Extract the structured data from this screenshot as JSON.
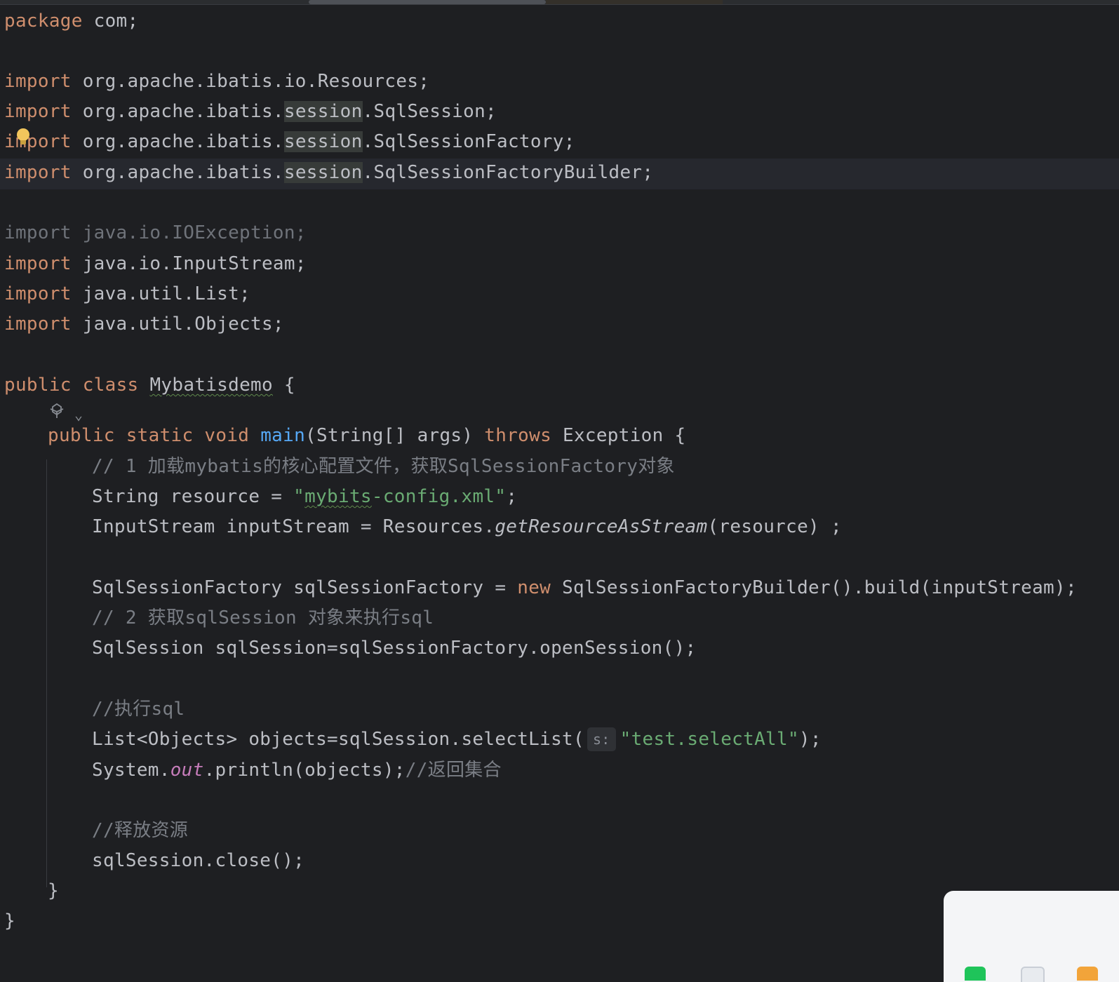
{
  "editor": {
    "lines": {
      "l01": {
        "kw": "package",
        "text": " com;"
      },
      "l03": {
        "kw": "import",
        "text": " org.apache.ibatis.io.Resources;"
      },
      "l04": {
        "kw": "import",
        "pre": " org.apache.ibatis.",
        "hl": "session",
        "post": ".SqlSession;"
      },
      "l05": {
        "kw": "import",
        "pre": " org.apache.ibatis.",
        "hl": "session",
        "post": ".SqlSessionFactory;"
      },
      "l06": {
        "kw": "import",
        "pre": " org.apache.ibatis.",
        "hl": "session",
        "post": ".SqlSessionFactoryBuilder;"
      },
      "l08": {
        "text": "import java.io.IOException;"
      },
      "l09": {
        "kw": "import",
        "text": " java.io.InputStream;"
      },
      "l10": {
        "kw": "import",
        "text": " java.util.List;"
      },
      "l11": {
        "kw": "import",
        "text": " java.util.Objects;"
      },
      "l13": {
        "kw1": "public",
        "kw2": "class",
        "cls": "Mybatisdemo",
        "post": " {"
      },
      "l14": {
        "kw1": "public",
        "kw2": "static",
        "kw3": "void",
        "fn": "main",
        "mid": "(String[] args) ",
        "kw4": "throws",
        "post": " Exception {"
      },
      "l15": {
        "text": "// 1 加载mybatis的核心配置文件，获取SqlSessionFactory对象"
      },
      "l16": {
        "pre": "String resource = ",
        "q1": "\"",
        "typo": "mybits",
        "str": "-config.xml\"",
        "post": ";"
      },
      "l17": {
        "pre": "InputStream inputStream = Resources.",
        "it": "getResourceAsStream",
        "post": "(resource) ;"
      },
      "l19": {
        "pre": "SqlSessionFactory sqlSessionFactory = ",
        "kw": "new",
        "post": " SqlSessionFactoryBuilder().build(inputStream);"
      },
      "l20": {
        "text": "// 2 获取sqlSession 对象来执行sql"
      },
      "l21": {
        "text": "SqlSession sqlSession=sqlSessionFactory.openSession();"
      },
      "l23": {
        "text": "//执行sql"
      },
      "l24": {
        "pre": "List<Objects> objects=sqlSession.selectList(",
        "hint": "s:",
        "str": "\"test.selectAll\"",
        "post": ");"
      },
      "l25": {
        "pre": "System.",
        "field": "out",
        "mid": ".println(objects);",
        "cmt": "//返回集合"
      },
      "l27": {
        "text": "//释放资源"
      },
      "l28": {
        "text": "sqlSession.close();"
      },
      "l29": {
        "text": "}"
      },
      "l30": {
        "text": "}"
      }
    },
    "lens_icon": "ai-assistant-icon",
    "lens_chevron": "⌄",
    "intention_icon": "lightbulb-icon",
    "colors": {
      "background": "#1e1f22",
      "keyword": "#cf8e6d",
      "function": "#56a8f5",
      "string": "#6aab73",
      "comment": "#7a7e85",
      "static_field": "#c77dbb"
    }
  }
}
